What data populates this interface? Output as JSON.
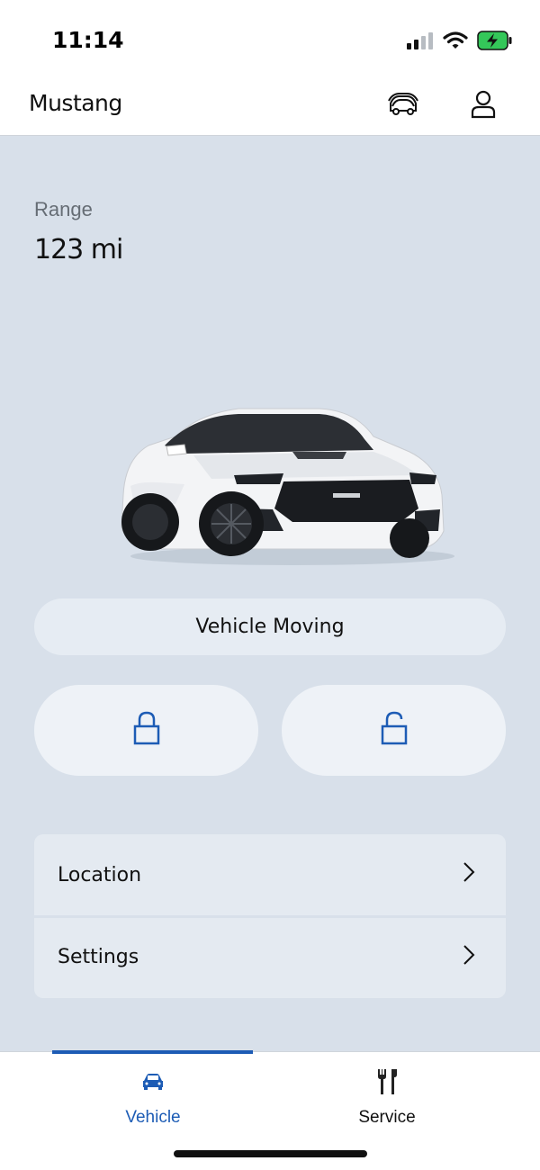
{
  "status_bar": {
    "time": "11:14",
    "icons": [
      "signal-icon",
      "wifi-icon",
      "battery-charging-icon"
    ]
  },
  "header": {
    "title": "Mustang",
    "icons": [
      "garage-vehicles-icon",
      "account-icon"
    ]
  },
  "range": {
    "label": "Range",
    "value": "123 mi"
  },
  "vehicle_status": "Vehicle Moving",
  "lock_controls": {
    "lock_icon": "lock-icon",
    "unlock_icon": "unlock-icon",
    "accent_color": "#1d5cb5"
  },
  "menu": {
    "items": [
      {
        "label": "Location"
      },
      {
        "label": "Settings"
      }
    ]
  },
  "tabbar": {
    "tabs": [
      {
        "label": "Vehicle",
        "icon": "car-icon",
        "active": true
      },
      {
        "label": "Service",
        "icon": "tools-icon",
        "active": false
      }
    ],
    "active_color": "#1d5cb5"
  }
}
